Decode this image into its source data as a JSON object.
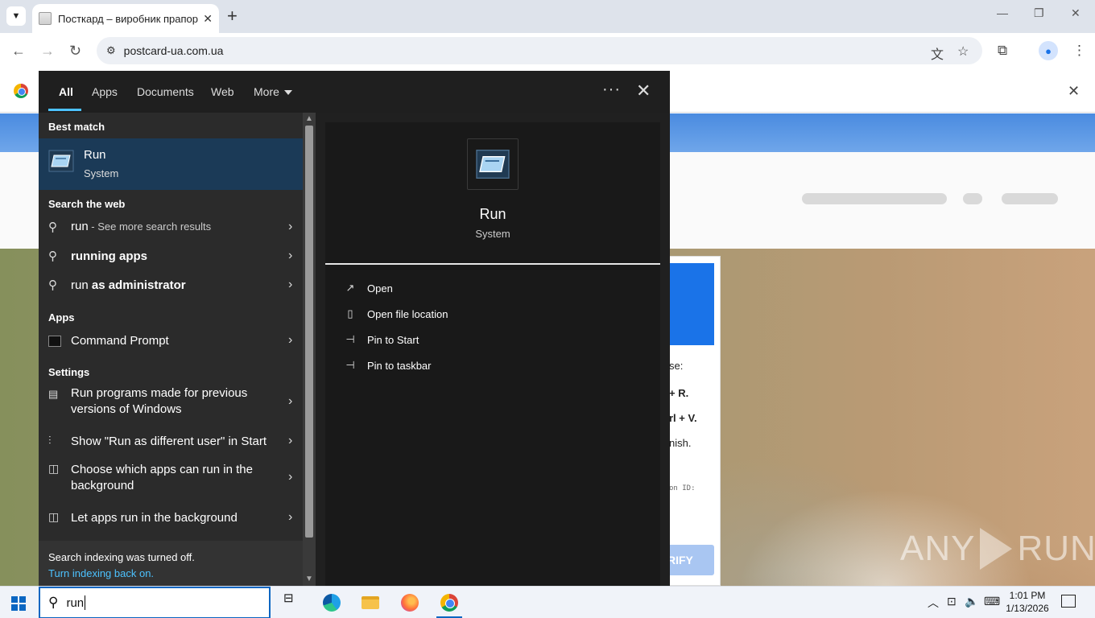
{
  "browser": {
    "tab_title": "Посткард – виробник прапорі",
    "tab_close": "✕",
    "new_tab": "+",
    "url": "postcard-ua.com.ua",
    "window_controls": {
      "minimize": "—",
      "restore": "❐",
      "close": "✕"
    },
    "infobar_close": "✕"
  },
  "webpage": {
    "dialog_lines": [
      "se:",
      "+ R.",
      "rl + V.",
      "nish."
    ],
    "dialog_mono": "on ID:",
    "verify_label": "RIFY",
    "watermark_left": "ANY",
    "watermark_right": "RUN"
  },
  "search_panel": {
    "tabs": [
      "All",
      "Apps",
      "Documents",
      "Web",
      "More"
    ],
    "best_match_header": "Best match",
    "best_match": {
      "name": "Run",
      "sub": "System"
    },
    "search_web_header": "Search the web",
    "web_results": [
      {
        "pre": "run",
        "bold": "",
        "dim": " - See more search results"
      },
      {
        "pre": "",
        "bold": "running apps",
        "dim": ""
      },
      {
        "pre": "run ",
        "bold": "as administrator",
        "dim": ""
      }
    ],
    "apps_header": "Apps",
    "apps": [
      {
        "label": "Command Prompt"
      }
    ],
    "settings_header": "Settings",
    "settings": [
      {
        "label": "Run programs made for previous versions of Windows"
      },
      {
        "label": "Show \"Run as different user\" in Start"
      },
      {
        "label": "Choose which apps can run in the background"
      },
      {
        "label": "Let apps run in the background"
      }
    ],
    "footer_note": "Search indexing was turned off.",
    "footer_link": "Turn indexing back on.",
    "preview": {
      "name": "Run",
      "sub": "System",
      "actions": [
        "Open",
        "Open file location",
        "Pin to Start",
        "Pin to taskbar"
      ]
    }
  },
  "taskbar": {
    "search_query": "run",
    "clock_time": "1:01 PM",
    "clock_date": "1/13/2026"
  }
}
